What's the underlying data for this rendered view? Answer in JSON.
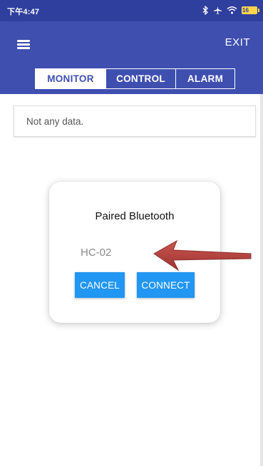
{
  "status_bar": {
    "time": "下午4:47",
    "icons": [
      "bluetooth-icon",
      "airplane-icon",
      "wifi-icon",
      "battery-icon"
    ],
    "battery_level": "16"
  },
  "app_bar": {
    "exit_label": "EXIT",
    "tabs": [
      {
        "label": "MONITOR",
        "active": true
      },
      {
        "label": "CONTROL",
        "active": false
      },
      {
        "label": "ALARM",
        "active": false
      }
    ],
    "colors": {
      "primary": "#3f4fb0",
      "status": "#2f3f9e"
    }
  },
  "monitor": {
    "empty_text": "Not any data."
  },
  "dialog": {
    "title": "Paired Bluetooth",
    "devices": [
      "HC-02"
    ],
    "cancel_label": "CANCEL",
    "connect_label": "CONNECT",
    "button_color": "#2196f3"
  },
  "annotation": {
    "arrow_color": "#b8423f"
  }
}
